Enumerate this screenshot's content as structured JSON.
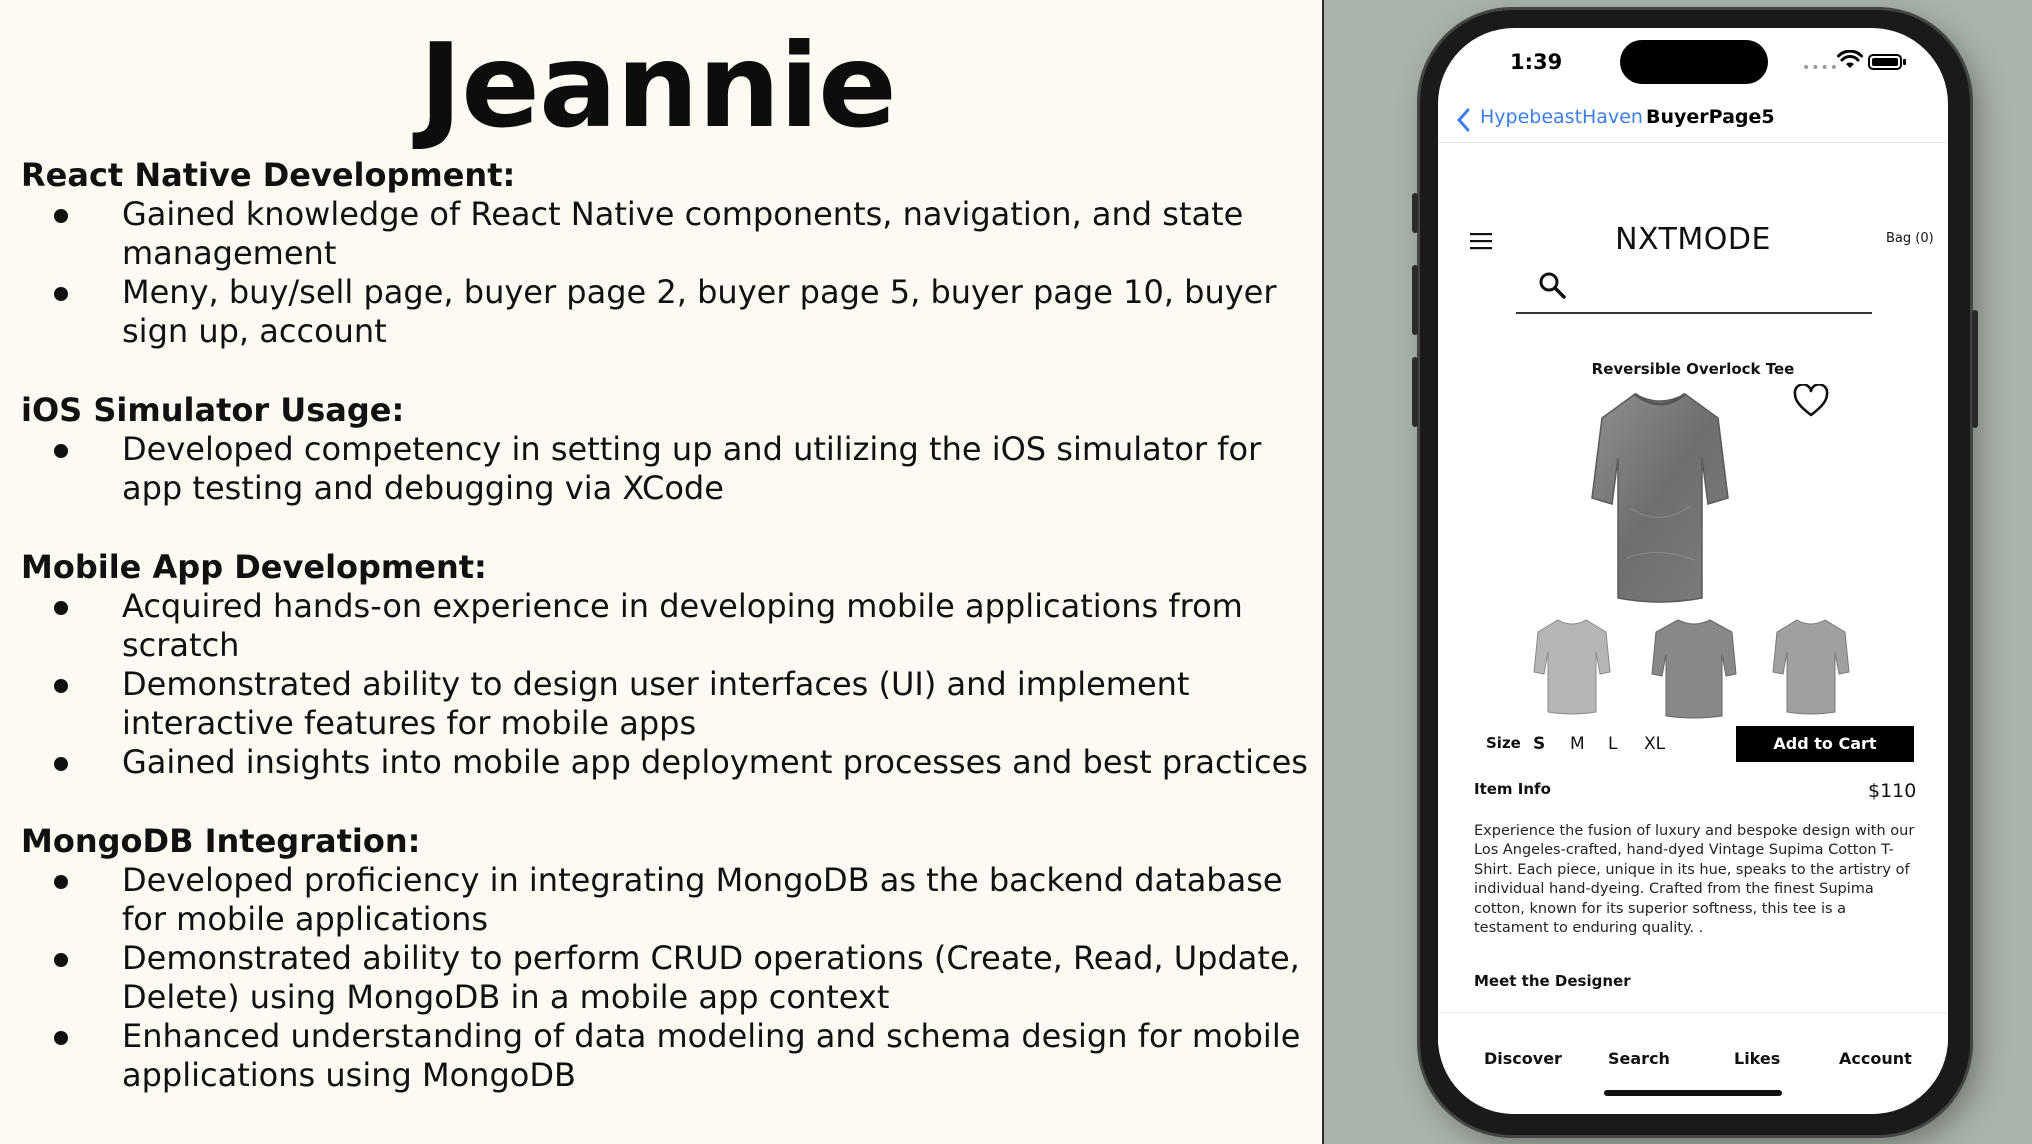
{
  "slide": {
    "title": "Jeannie",
    "sections": [
      {
        "heading": "React Native Development:",
        "bullets": [
          "Gained knowledge of React Native components, navigation, and state management",
          "Meny, buy/sell page, buyer page 2, buyer page 5, buyer page 10, buyer sign up, account"
        ]
      },
      {
        "heading": "iOS Simulator Usage:",
        "bullets": [
          "Developed competency in setting up and utilizing the iOS simulator for app testing and debugging via XCode"
        ]
      },
      {
        "heading": "Mobile App Development:",
        "bullets": [
          "Acquired hands-on experience in developing mobile applications from scratch",
          "Demonstrated ability to design user interfaces (UI) and implement interactive features for mobile apps",
          "Gained insights into mobile app deployment processes and best practices"
        ]
      },
      {
        "heading": "MongoDB Integration:",
        "bullets": [
          "Developed proficiency in integrating MongoDB as the backend database for mobile applications",
          "Demonstrated ability to perform CRUD operations (Create, Read, Update, Delete) using MongoDB in a mobile app context",
          "Enhanced understanding of data modeling and schema design for mobile applications using MongoDB"
        ]
      }
    ]
  },
  "phone": {
    "status_time": "1:39",
    "nav": {
      "back_label": "HypebeastHaven",
      "title": "BuyerPage5"
    },
    "header": {
      "brand": "NXTMODE",
      "bag_label": "Bag (0)"
    },
    "product": {
      "title": "Reversible Overlock Tee",
      "size_label": "Size",
      "sizes": [
        "S",
        "M",
        "L",
        "XL"
      ],
      "selected_size": "S",
      "add_to_cart_label": "Add to Cart",
      "item_info_label": "Item Info",
      "price": "$110",
      "description": "Experience the fusion of luxury and bespoke design with our Los Angeles-crafted, hand-dyed Vintage Supima Cotton T-Shirt. Each piece, unique in its hue, speaks to the artistry of individual hand-dyeing. Crafted from the finest Supima cotton, known for its superior softness, this tee is a testament to enduring quality. .",
      "designer_label": "Meet the Designer"
    },
    "tabs": [
      "Discover",
      "Search",
      "Likes",
      "Account"
    ],
    "icons": {
      "back": "chevron-left-icon",
      "menu": "hamburger-menu-icon",
      "search": "search-icon",
      "heart": "heart-icon",
      "wifi": "wifi-icon",
      "battery": "battery-icon"
    },
    "colors": {
      "link": "#3a7ef0",
      "button_bg": "#000000"
    }
  }
}
